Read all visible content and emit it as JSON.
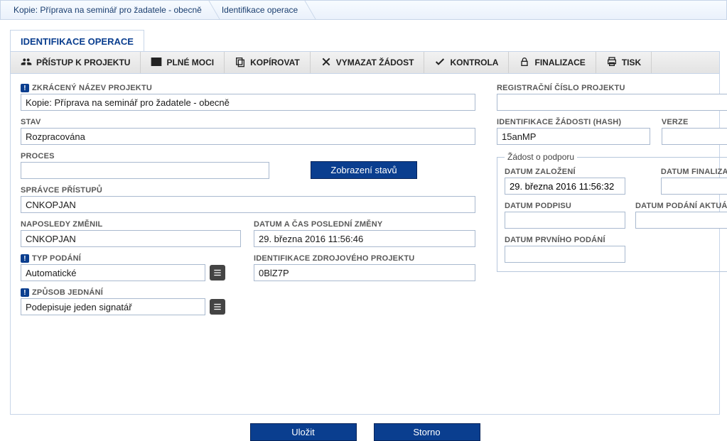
{
  "breadcrumb": {
    "item1": "Kopie: Příprava na seminář pro žadatele - obecně",
    "item2": "Identifikace operace"
  },
  "tab": {
    "title": "IDENTIFIKACE OPERACE"
  },
  "toolbar": {
    "access": "PŘÍSTUP K PROJEKTU",
    "poa": "PLNÉ MOCI",
    "copy": "KOPÍROVAT",
    "delete": "VYMAZAT ŽÁDOST",
    "check": "KONTROLA",
    "finalize": "FINALIZACE",
    "print": "TISK"
  },
  "labels": {
    "short_name": "ZKRÁCENÝ NÁZEV PROJEKTU",
    "state": "STAV",
    "process": "PROCES",
    "show_states": "Zobrazení stavů",
    "access_admin": "SPRÁVCE PŘÍSTUPŮ",
    "last_changed_by": "NAPOSLEDY ZMĚNIL",
    "last_changed_at": "DATUM A ČAS POSLEDNÍ ZMĚNY",
    "sub_type": "TYP PODÁNÍ",
    "src_id": "IDENTIFIKACE ZDROJOVÉHO PROJEKTU",
    "act_mode": "ZPŮSOB JEDNÁNÍ",
    "reg_no": "REGISTRAČNÍ ČÍSLO PROJEKTU",
    "hash": "IDENTIFIKACE ŽÁDOSTI (HASH)",
    "version": "VERZE",
    "grp_title": "Žádost o podporu",
    "created": "DATUM ZALOŽENÍ",
    "final_date": "DATUM FINALIZACE",
    "sign_date": "DATUM PODPISU",
    "submit_date": "DATUM PODÁNÍ AKTUÁLNÍ VERZE ŽÁDOSTI",
    "first_submit": "DATUM PRVNÍHO PODÁNÍ"
  },
  "values": {
    "short_name": "Kopie: Příprava na seminář pro žadatele - obecně",
    "state": "Rozpracována",
    "process": "",
    "access_admin": "CNKOPJAN",
    "last_changed_by": "CNKOPJAN",
    "last_changed_at": "29. března 2016 11:56:46",
    "sub_type": "Automatické",
    "src_id": "0BlZ7P",
    "act_mode": "Podepisuje jeden signatář",
    "reg_no": "",
    "hash": "15anMP",
    "version": "",
    "created": "29. března 2016 11:56:32",
    "final_date": "",
    "sign_date": "",
    "submit_date": "",
    "first_submit": ""
  },
  "buttons": {
    "save": "Uložit",
    "cancel": "Storno"
  }
}
